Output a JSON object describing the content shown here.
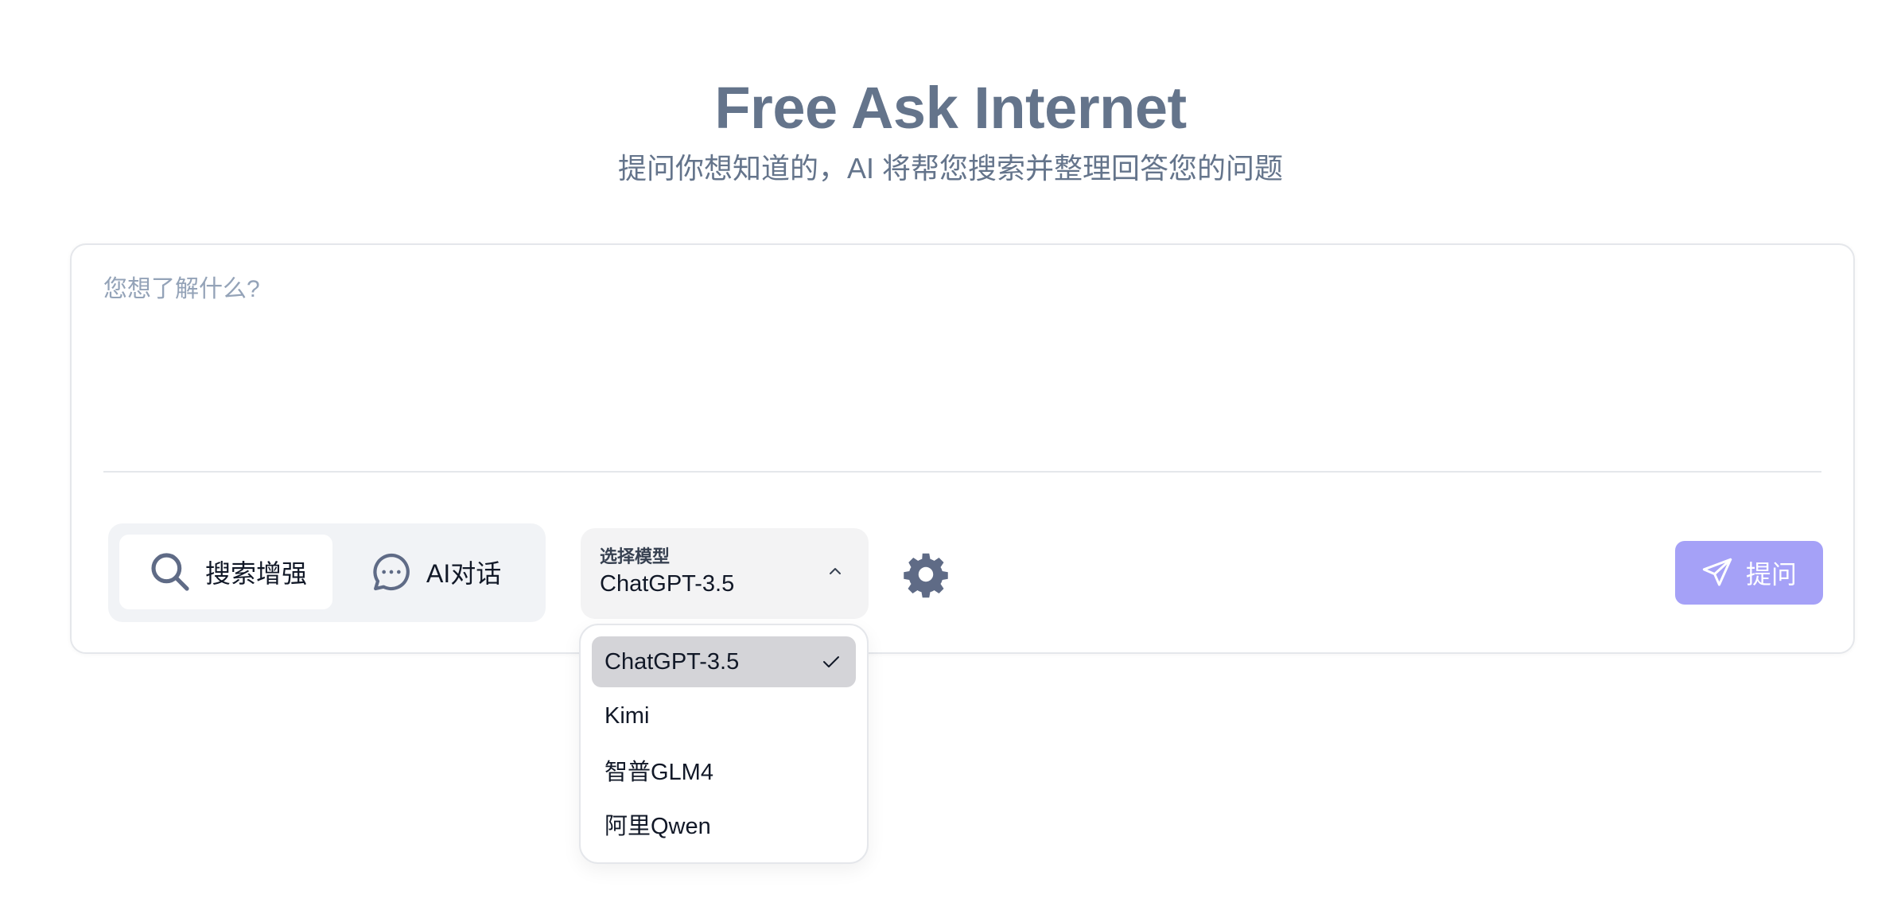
{
  "header": {
    "title": "Free Ask Internet",
    "subtitle": "提问你想知道的，AI 将帮您搜索并整理回答您的问题"
  },
  "question": {
    "value": "",
    "placeholder": "您想了解什么?"
  },
  "mode_toggle": {
    "search_label": "搜索增强",
    "search_icon": "search-icon",
    "chat_label": "AI对话",
    "chat_icon": "chat-bubble-icon",
    "active": "search"
  },
  "model_select": {
    "label": "选择模型",
    "selected": "ChatGPT-3.5",
    "expanded": true,
    "options": [
      "ChatGPT-3.5",
      "Kimi",
      "智普GLM4",
      "阿里Qwen"
    ]
  },
  "settings": {
    "icon": "gear-icon"
  },
  "submit": {
    "label": "提问",
    "icon": "send-icon"
  },
  "colors": {
    "title": "#64748b",
    "accent": "#a5a1f7",
    "icon": "#5f6b86"
  }
}
